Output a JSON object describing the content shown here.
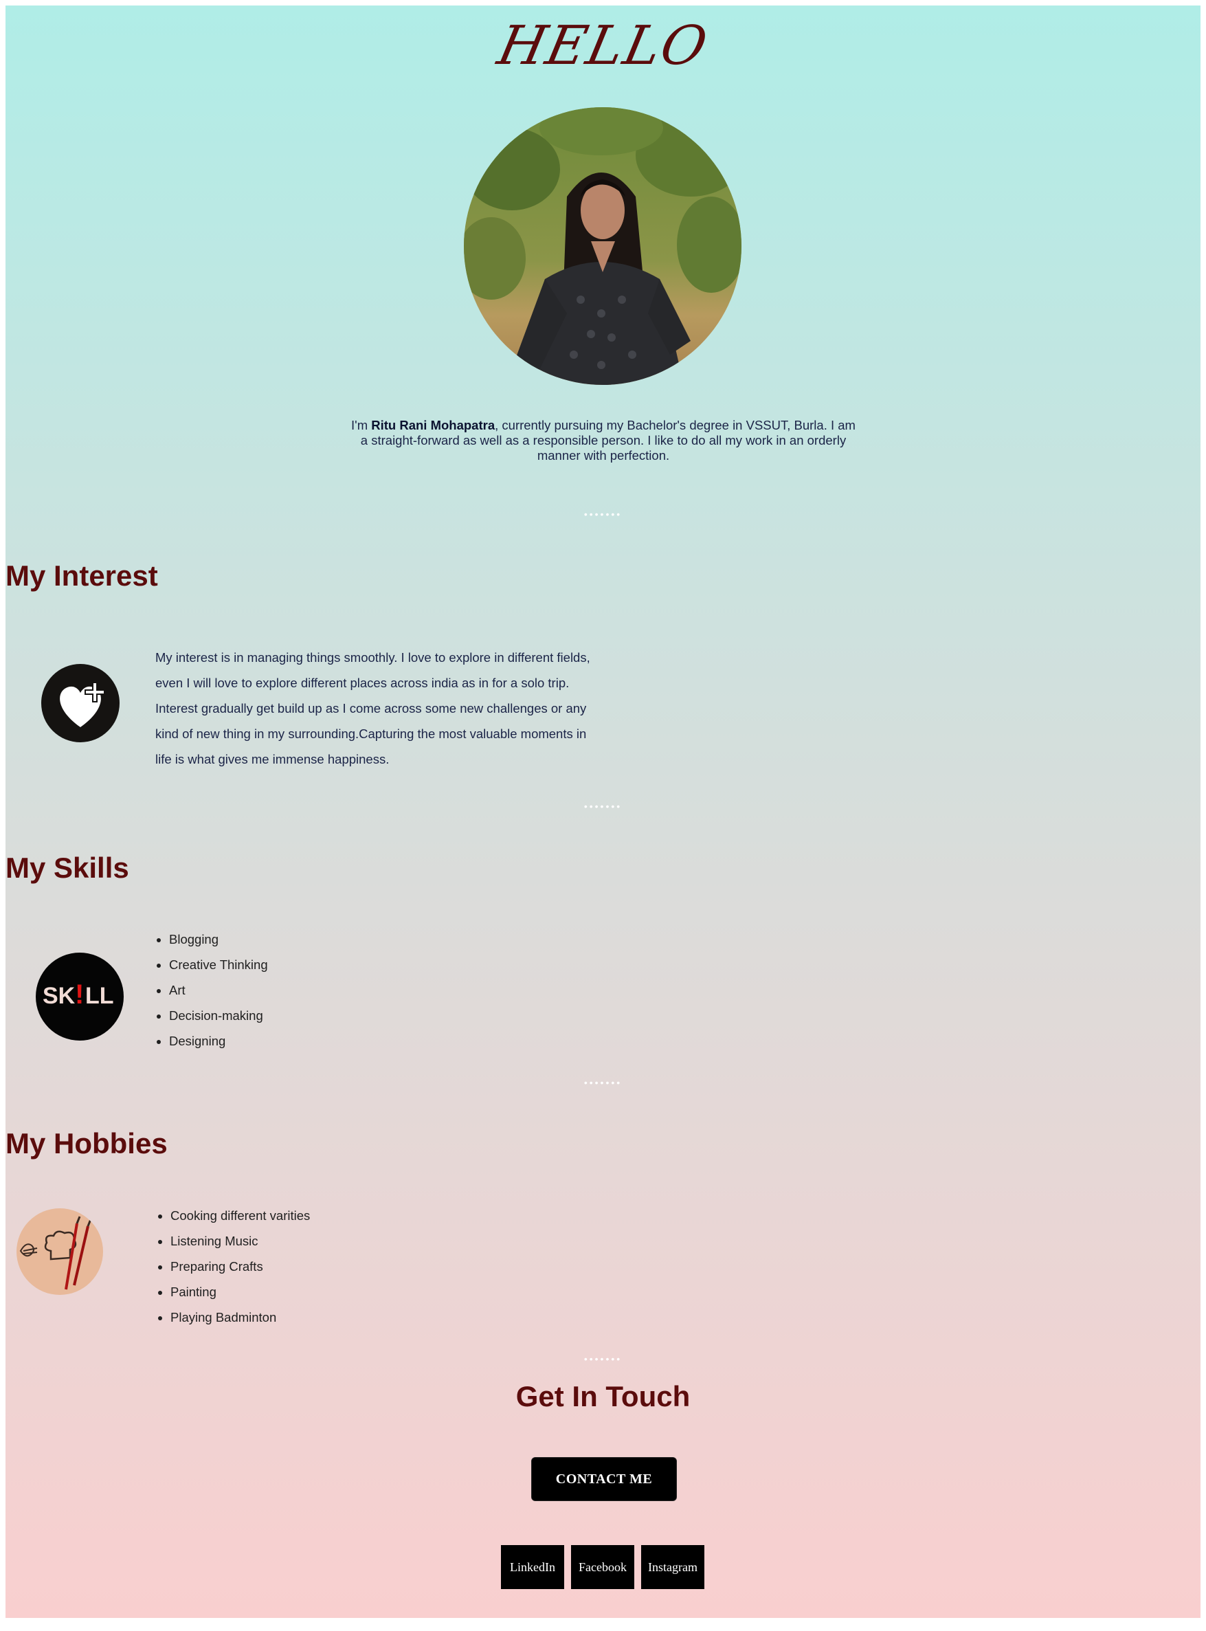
{
  "header": {
    "title": "HELLO"
  },
  "intro": {
    "prefix": "I'm ",
    "name": "Ritu Rani Mohapatra",
    "rest": ", currently pursuing my Bachelor's degree in VSSUT, Burla. I am a straight-forward as well as a responsible person. I like to do all my work in an orderly manner with perfection."
  },
  "divider": "•••••••",
  "interest": {
    "title": "My Interest",
    "text": "My interest is in managing things smoothly. I love to explore in different fields, even I will love to explore different places across india as in for a solo trip. Interest gradually get build up as I come across some new challenges or any kind of new thing in my surrounding.Capturing the most valuable moments in life is what gives me immense happiness."
  },
  "skills": {
    "title": "My Skills",
    "badge_text": {
      "left": "SK",
      "mark": "!",
      "right": "LL"
    },
    "items": [
      "Blogging",
      "Creative Thinking",
      "Art",
      "Decision-making",
      "Designing"
    ]
  },
  "hobbies": {
    "title": "My Hobbies",
    "items": [
      "Cooking different varities",
      "Listening Music",
      "Preparing Crafts",
      "Painting",
      "Playing Badminton"
    ]
  },
  "contact": {
    "title": "Get In Touch",
    "button": "CONTACT ME",
    "links": [
      "LinkedIn",
      "Facebook",
      "Instagram"
    ]
  },
  "colors": {
    "heading": "#5b0c0c",
    "body_text": "#1b2447",
    "gradient_top": "#b0ede7",
    "gradient_bottom": "#f9cfcf",
    "button_bg": "#000000"
  },
  "icons": [
    "profile-photo",
    "heart-plus-icon",
    "skill-badge-icon",
    "hobbies-icon"
  ]
}
